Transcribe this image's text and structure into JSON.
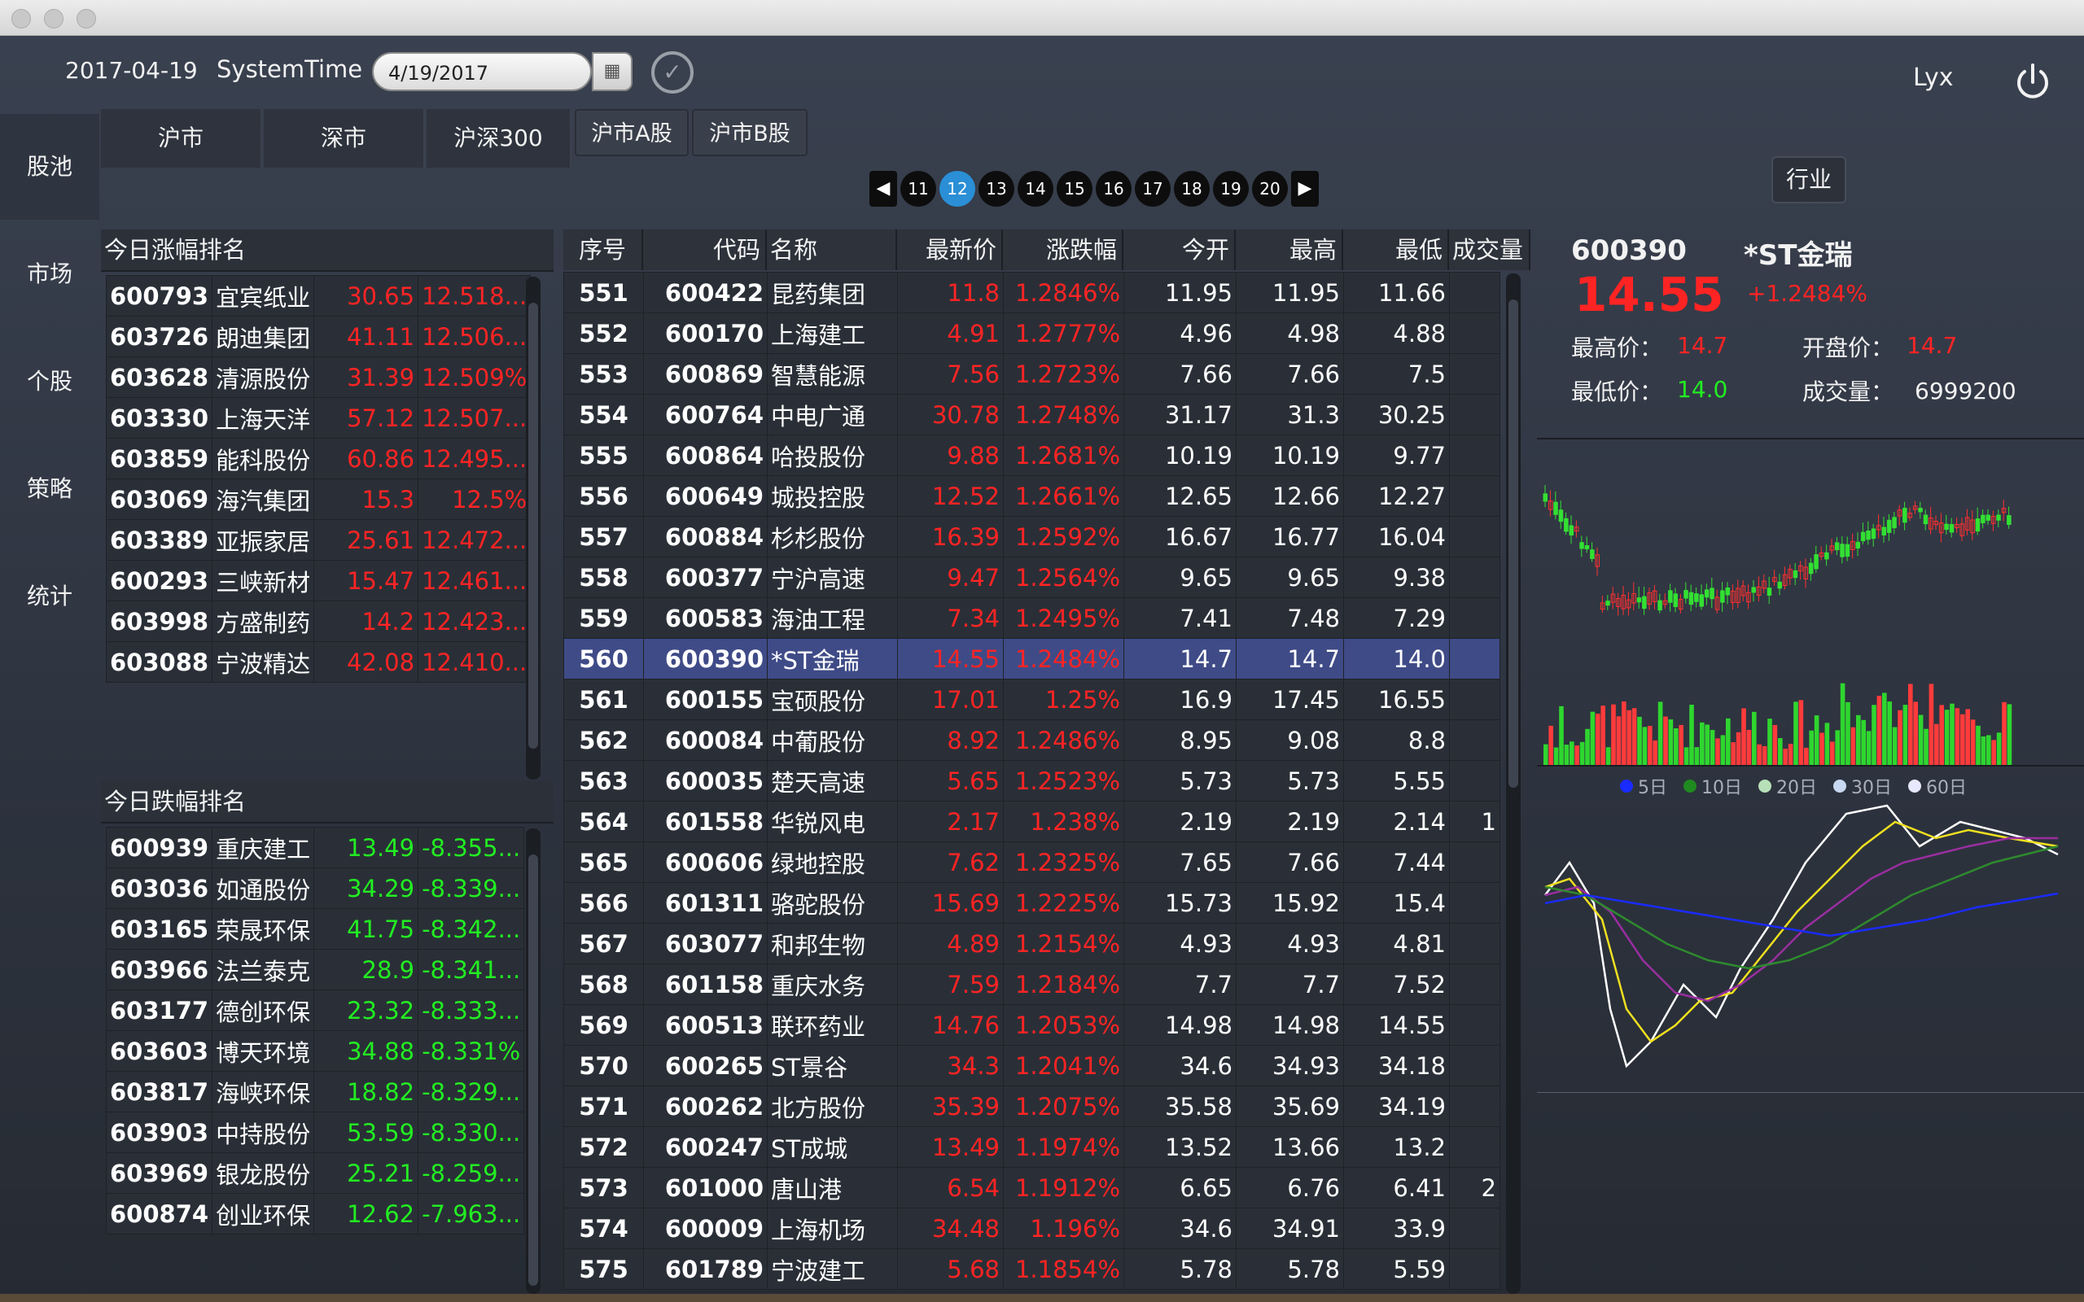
{
  "header": {
    "date": "2017-04-19",
    "systime_label": "SystemTime",
    "date_input": "4/19/2017",
    "user": "Lyx"
  },
  "nav": [
    {
      "label": "股池"
    },
    {
      "label": "市场"
    },
    {
      "label": "个股"
    },
    {
      "label": "策略"
    },
    {
      "label": "统计"
    }
  ],
  "market_tabs": [
    "沪市",
    "深市",
    "沪深300"
  ],
  "sub_tabs": [
    "沪市A股",
    "沪市B股"
  ],
  "pager": {
    "pages": [
      "11",
      "12",
      "13",
      "14",
      "15",
      "16",
      "17",
      "18",
      "19",
      "20"
    ],
    "active": "12",
    "prev": "◀",
    "next": "▶"
  },
  "industry_label": "行业",
  "gainers": {
    "title": "今日涨幅排名",
    "rows": [
      {
        "code": "600793",
        "name": "宜宾纸业",
        "price": "30.65",
        "pct": "12.518..."
      },
      {
        "code": "603726",
        "name": "朗迪集团",
        "price": "41.11",
        "pct": "12.506..."
      },
      {
        "code": "603628",
        "name": "清源股份",
        "price": "31.39",
        "pct": "12.509%"
      },
      {
        "code": "603330",
        "name": "上海天洋",
        "price": "57.12",
        "pct": "12.507..."
      },
      {
        "code": "603859",
        "name": "能科股份",
        "price": "60.86",
        "pct": "12.495..."
      },
      {
        "code": "603069",
        "name": "海汽集团",
        "price": "15.3",
        "pct": "12.5%"
      },
      {
        "code": "603389",
        "name": "亚振家居",
        "price": "25.61",
        "pct": "12.472..."
      },
      {
        "code": "600293",
        "name": "三峡新材",
        "price": "15.47",
        "pct": "12.461..."
      },
      {
        "code": "603998",
        "name": "方盛制药",
        "price": "14.2",
        "pct": "12.423..."
      },
      {
        "code": "603088",
        "name": "宁波精达",
        "price": "42.08",
        "pct": "12.410..."
      }
    ]
  },
  "losers": {
    "title": "今日跌幅排名",
    "rows": [
      {
        "code": "600939",
        "name": "重庆建工",
        "price": "13.49",
        "pct": "-8.355..."
      },
      {
        "code": "603036",
        "name": "如通股份",
        "price": "34.29",
        "pct": "-8.339..."
      },
      {
        "code": "603165",
        "name": "荣晟环保",
        "price": "41.75",
        "pct": "-8.342..."
      },
      {
        "code": "603966",
        "name": "法兰泰克",
        "price": "28.9",
        "pct": "-8.341..."
      },
      {
        "code": "603177",
        "name": "德创环保",
        "price": "23.32",
        "pct": "-8.333..."
      },
      {
        "code": "603603",
        "name": "博天环境",
        "price": "34.88",
        "pct": "-8.331%"
      },
      {
        "code": "603817",
        "name": "海峡环保",
        "price": "18.82",
        "pct": "-8.329..."
      },
      {
        "code": "603903",
        "name": "中持股份",
        "price": "53.59",
        "pct": "-8.330..."
      },
      {
        "code": "603969",
        "name": "银龙股份",
        "price": "25.21",
        "pct": "-8.259..."
      },
      {
        "code": "600874",
        "name": "创业环保",
        "price": "12.62",
        "pct": "-7.963..."
      }
    ]
  },
  "main": {
    "headers": [
      "序号",
      "代码",
      "名称",
      "最新价",
      "涨跌幅",
      "今开",
      "最高",
      "最低",
      "成交量"
    ],
    "rows": [
      {
        "seq": "551",
        "code": "600422",
        "name": "昆药集团",
        "last": "11.8",
        "chg": "1.2846%",
        "open": "11.95",
        "high": "11.95",
        "low": "11.66",
        "vol": ""
      },
      {
        "seq": "552",
        "code": "600170",
        "name": "上海建工",
        "last": "4.91",
        "chg": "1.2777%",
        "open": "4.96",
        "high": "4.98",
        "low": "4.88",
        "vol": ""
      },
      {
        "seq": "553",
        "code": "600869",
        "name": "智慧能源",
        "last": "7.56",
        "chg": "1.2723%",
        "open": "7.66",
        "high": "7.66",
        "low": "7.5",
        "vol": ""
      },
      {
        "seq": "554",
        "code": "600764",
        "name": "中电广通",
        "last": "30.78",
        "chg": "1.2748%",
        "open": "31.17",
        "high": "31.3",
        "low": "30.25",
        "vol": ""
      },
      {
        "seq": "555",
        "code": "600864",
        "name": "哈投股份",
        "last": "9.88",
        "chg": "1.2681%",
        "open": "10.19",
        "high": "10.19",
        "low": "9.77",
        "vol": ""
      },
      {
        "seq": "556",
        "code": "600649",
        "name": "城投控股",
        "last": "12.52",
        "chg": "1.2661%",
        "open": "12.65",
        "high": "12.66",
        "low": "12.27",
        "vol": ""
      },
      {
        "seq": "557",
        "code": "600884",
        "name": "杉杉股份",
        "last": "16.39",
        "chg": "1.2592%",
        "open": "16.67",
        "high": "16.77",
        "low": "16.04",
        "vol": ""
      },
      {
        "seq": "558",
        "code": "600377",
        "name": "宁沪高速",
        "last": "9.47",
        "chg": "1.2564%",
        "open": "9.65",
        "high": "9.65",
        "low": "9.38",
        "vol": ""
      },
      {
        "seq": "559",
        "code": "600583",
        "name": "海油工程",
        "last": "7.34",
        "chg": "1.2495%",
        "open": "7.41",
        "high": "7.48",
        "low": "7.29",
        "vol": ""
      },
      {
        "seq": "560",
        "code": "600390",
        "name": "*ST金瑞",
        "last": "14.55",
        "chg": "1.2484%",
        "open": "14.7",
        "high": "14.7",
        "low": "14.0",
        "vol": "",
        "selected": true
      },
      {
        "seq": "561",
        "code": "600155",
        "name": "宝硕股份",
        "last": "17.01",
        "chg": "1.25%",
        "open": "16.9",
        "high": "17.45",
        "low": "16.55",
        "vol": ""
      },
      {
        "seq": "562",
        "code": "600084",
        "name": "中葡股份",
        "last": "8.92",
        "chg": "1.2486%",
        "open": "8.95",
        "high": "9.08",
        "low": "8.8",
        "vol": ""
      },
      {
        "seq": "563",
        "code": "600035",
        "name": "楚天高速",
        "last": "5.65",
        "chg": "1.2523%",
        "open": "5.73",
        "high": "5.73",
        "low": "5.55",
        "vol": ""
      },
      {
        "seq": "564",
        "code": "601558",
        "name": "华锐风电",
        "last": "2.17",
        "chg": "1.238%",
        "open": "2.19",
        "high": "2.19",
        "low": "2.14",
        "vol": "1"
      },
      {
        "seq": "565",
        "code": "600606",
        "name": "绿地控股",
        "last": "7.62",
        "chg": "1.2325%",
        "open": "7.65",
        "high": "7.66",
        "low": "7.44",
        "vol": ""
      },
      {
        "seq": "566",
        "code": "601311",
        "name": "骆驼股份",
        "last": "15.69",
        "chg": "1.2225%",
        "open": "15.73",
        "high": "15.92",
        "low": "15.4",
        "vol": ""
      },
      {
        "seq": "567",
        "code": "603077",
        "name": "和邦生物",
        "last": "4.89",
        "chg": "1.2154%",
        "open": "4.93",
        "high": "4.93",
        "low": "4.81",
        "vol": ""
      },
      {
        "seq": "568",
        "code": "601158",
        "name": "重庆水务",
        "last": "7.59",
        "chg": "1.2184%",
        "open": "7.7",
        "high": "7.7",
        "low": "7.52",
        "vol": ""
      },
      {
        "seq": "569",
        "code": "600513",
        "name": "联环药业",
        "last": "14.76",
        "chg": "1.2053%",
        "open": "14.98",
        "high": "14.98",
        "low": "14.55",
        "vol": ""
      },
      {
        "seq": "570",
        "code": "600265",
        "name": "ST景谷",
        "last": "34.3",
        "chg": "1.2041%",
        "open": "34.6",
        "high": "34.93",
        "low": "34.18",
        "vol": ""
      },
      {
        "seq": "571",
        "code": "600262",
        "name": "北方股份",
        "last": "35.39",
        "chg": "1.2075%",
        "open": "35.58",
        "high": "35.69",
        "low": "34.19",
        "vol": ""
      },
      {
        "seq": "572",
        "code": "600247",
        "name": "ST成城",
        "last": "13.49",
        "chg": "1.1974%",
        "open": "13.52",
        "high": "13.66",
        "low": "13.2",
        "vol": ""
      },
      {
        "seq": "573",
        "code": "601000",
        "name": "唐山港",
        "last": "6.54",
        "chg": "1.1912%",
        "open": "6.65",
        "high": "6.76",
        "low": "6.41",
        "vol": "2"
      },
      {
        "seq": "574",
        "code": "600009",
        "name": "上海机场",
        "last": "34.48",
        "chg": "1.196%",
        "open": "34.6",
        "high": "34.91",
        "low": "33.9",
        "vol": ""
      },
      {
        "seq": "575",
        "code": "601789",
        "name": "宁波建工",
        "last": "5.68",
        "chg": "1.1854%",
        "open": "5.78",
        "high": "5.78",
        "low": "5.59",
        "vol": ""
      }
    ]
  },
  "detail": {
    "code": "600390",
    "name": "*ST金瑞",
    "price": "14.55",
    "change": "+1.2484%",
    "high_label": "最高价：",
    "high": "14.7",
    "open_label": "开盘价：",
    "open": "14.7",
    "low_label": "最低价：",
    "low": "14.0",
    "vol_label": "成交量：",
    "vol": "6999200"
  },
  "ma_legend": [
    {
      "label": "5日",
      "color": "#1a2bff"
    },
    {
      "label": "10日",
      "color": "#1f8a1f"
    },
    {
      "label": "20日",
      "color": "#b8e0b8"
    },
    {
      "label": "30日",
      "color": "#c8d8f0"
    },
    {
      "label": "60日",
      "color": "#e8e8ff"
    }
  ],
  "colors": {
    "up": "#ff2424",
    "down": "#22ee22",
    "accent": "#2a8fd6",
    "selected_row": "#3f4b87"
  }
}
